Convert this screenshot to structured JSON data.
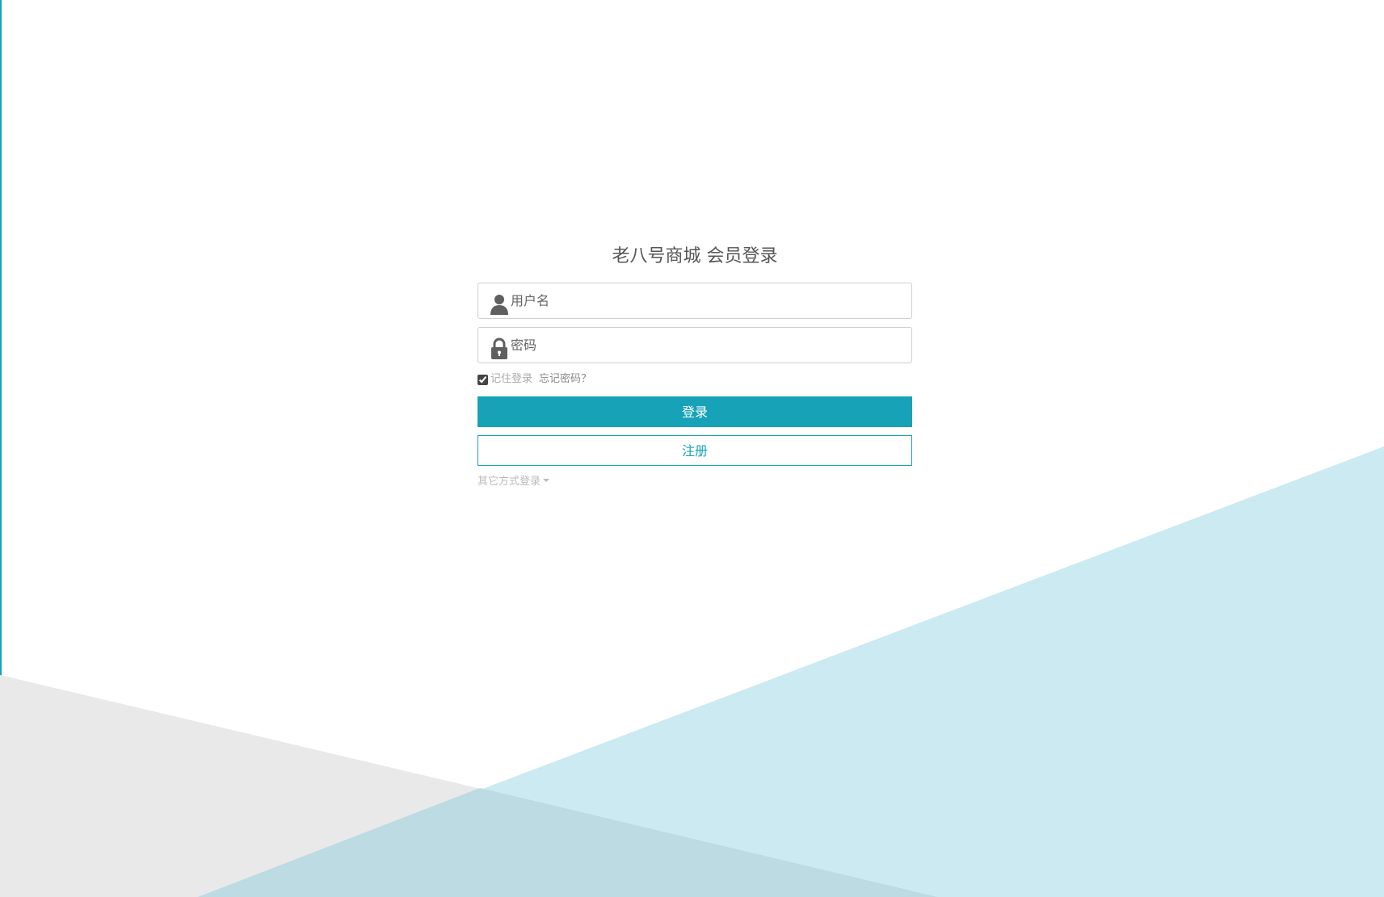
{
  "page": {
    "title": "老八号商城 会员登录",
    "accent_color": "#17a2b8",
    "background_shapes": {
      "gray": "#e9e9e9",
      "blue": "#cbeaf1",
      "overlap": "#bcdbe2"
    }
  },
  "form": {
    "username": {
      "placeholder": "用户名",
      "value": "",
      "icon": "user-icon"
    },
    "password": {
      "placeholder": "密码",
      "value": "",
      "icon": "lock-icon"
    },
    "remember": {
      "label": "记住登录",
      "checked": true
    },
    "forgot_label": "忘记密码？",
    "login_label": "登录",
    "register_label": "注册",
    "other_login_label": "其它方式登录"
  }
}
